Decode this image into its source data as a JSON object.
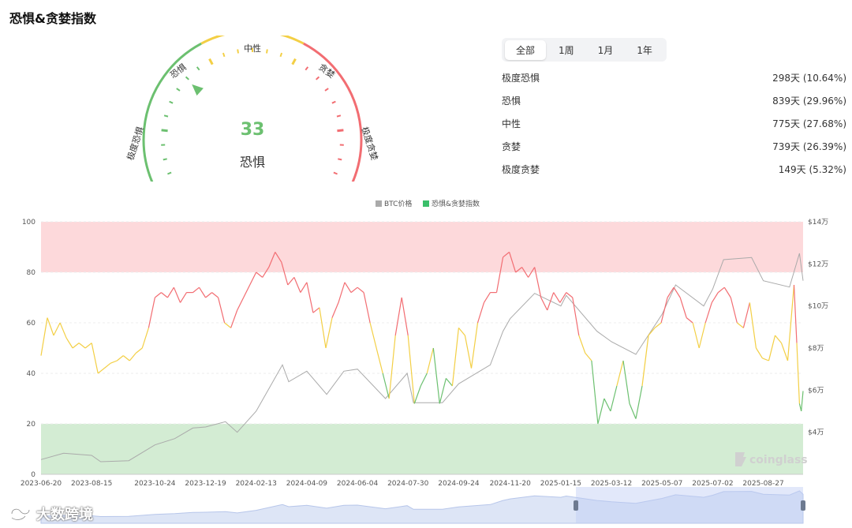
{
  "title": "恐惧&贪婪指数",
  "gauge": {
    "value": "33",
    "value_num": 33,
    "status": "恐惧",
    "labels": {
      "extreme_fear": "极度恐惧",
      "fear": "恐惧",
      "neutral": "中性",
      "greed": "贪婪",
      "extreme_greed": "极度贪婪"
    },
    "colors": {
      "fear": "#6cc070",
      "neutral": "#f3cf45",
      "greed": "#f26d72"
    }
  },
  "tabs": [
    {
      "label": "全部",
      "active": true
    },
    {
      "label": "1周",
      "active": false
    },
    {
      "label": "1月",
      "active": false
    },
    {
      "label": "1年",
      "active": false
    }
  ],
  "stats": [
    {
      "label": "极度恐惧",
      "value": "298天 (10.64%)"
    },
    {
      "label": "恐惧",
      "value": "839天 (29.96%)"
    },
    {
      "label": "中性",
      "value": "775天 (27.68%)"
    },
    {
      "label": "贪婪",
      "value": "739天 (26.39%)"
    },
    {
      "label": "极度贪婪",
      "value": "149天 (5.32%)"
    }
  ],
  "chart_data": {
    "type": "line",
    "legend": [
      "BTC价格",
      "恐惧&贪婪指数"
    ],
    "legend_position": "top-center",
    "colors": {
      "btc": "#aaaaaa",
      "fear": "#6cc070",
      "neutral": "#f3cf45",
      "greed": "#f26d72",
      "greed_band": "#fdd9db",
      "fear_band": "#d3ecd3"
    },
    "y_left": {
      "min": 0,
      "max": 100,
      "ticks": [
        "0",
        "20",
        "40",
        "60",
        "80",
        "100"
      ]
    },
    "y_right": {
      "min": 20000,
      "max": 140000,
      "ticks": [
        "$4万",
        "$6万",
        "$8万",
        "$10万",
        "$12万",
        "$14万"
      ],
      "tick_values": [
        40000,
        60000,
        80000,
        100000,
        120000,
        140000
      ]
    },
    "bands": [
      {
        "from": 80,
        "to": 100
      },
      {
        "from": 0,
        "to": 20
      }
    ],
    "x_ticks": [
      "2023-06-20",
      "2023-08-15",
      "2023-10-24",
      "2023-12-19",
      "2024-02-13",
      "2024-04-09",
      "2024-06-04",
      "2024-07-30",
      "2024-09-24",
      "2024-11-20",
      "2025-01-15",
      "2025-03-12",
      "2025-05-07",
      "2025-07-02",
      "2025-08-27"
    ],
    "x_start": "2023-06-20",
    "x_end": "2025-10-10",
    "series": [
      {
        "name": "恐惧&贪婪指数",
        "points": [
          [
            "2023-06-20",
            47
          ],
          [
            "2023-06-27",
            62
          ],
          [
            "2023-07-04",
            55
          ],
          [
            "2023-07-11",
            60
          ],
          [
            "2023-07-18",
            54
          ],
          [
            "2023-07-25",
            50
          ],
          [
            "2023-08-01",
            52
          ],
          [
            "2023-08-08",
            50
          ],
          [
            "2023-08-15",
            52
          ],
          [
            "2023-08-22",
            40
          ],
          [
            "2023-08-29",
            42
          ],
          [
            "2023-09-05",
            44
          ],
          [
            "2023-09-12",
            45
          ],
          [
            "2023-09-19",
            47
          ],
          [
            "2023-09-26",
            45
          ],
          [
            "2023-10-03",
            48
          ],
          [
            "2023-10-10",
            50
          ],
          [
            "2023-10-17",
            58
          ],
          [
            "2023-10-24",
            70
          ],
          [
            "2023-10-31",
            72
          ],
          [
            "2023-11-07",
            70
          ],
          [
            "2023-11-14",
            74
          ],
          [
            "2023-11-21",
            68
          ],
          [
            "2023-11-28",
            72
          ],
          [
            "2023-12-05",
            72
          ],
          [
            "2023-12-12",
            74
          ],
          [
            "2023-12-19",
            70
          ],
          [
            "2023-12-26",
            72
          ],
          [
            "2024-01-02",
            70
          ],
          [
            "2024-01-09",
            60
          ],
          [
            "2024-01-16",
            58
          ],
          [
            "2024-01-23",
            65
          ],
          [
            "2024-01-30",
            70
          ],
          [
            "2024-02-06",
            75
          ],
          [
            "2024-02-13",
            80
          ],
          [
            "2024-02-20",
            78
          ],
          [
            "2024-02-27",
            82
          ],
          [
            "2024-03-05",
            88
          ],
          [
            "2024-03-12",
            84
          ],
          [
            "2024-03-19",
            75
          ],
          [
            "2024-03-26",
            78
          ],
          [
            "2024-04-02",
            72
          ],
          [
            "2024-04-09",
            76
          ],
          [
            "2024-04-16",
            64
          ],
          [
            "2024-04-23",
            66
          ],
          [
            "2024-04-30",
            50
          ],
          [
            "2024-05-07",
            62
          ],
          [
            "2024-05-14",
            68
          ],
          [
            "2024-05-21",
            76
          ],
          [
            "2024-05-28",
            72
          ],
          [
            "2024-06-04",
            74
          ],
          [
            "2024-06-11",
            72
          ],
          [
            "2024-06-18",
            60
          ],
          [
            "2024-06-25",
            50
          ],
          [
            "2024-07-02",
            40
          ],
          [
            "2024-07-09",
            30
          ],
          [
            "2024-07-16",
            55
          ],
          [
            "2024-07-23",
            70
          ],
          [
            "2024-07-30",
            55
          ],
          [
            "2024-08-06",
            28
          ],
          [
            "2024-08-13",
            35
          ],
          [
            "2024-08-20",
            40
          ],
          [
            "2024-08-27",
            50
          ],
          [
            "2024-09-03",
            28
          ],
          [
            "2024-09-10",
            38
          ],
          [
            "2024-09-17",
            35
          ],
          [
            "2024-09-24",
            58
          ],
          [
            "2024-10-01",
            55
          ],
          [
            "2024-10-08",
            42
          ],
          [
            "2024-10-15",
            60
          ],
          [
            "2024-10-22",
            68
          ],
          [
            "2024-10-29",
            72
          ],
          [
            "2024-11-05",
            72
          ],
          [
            "2024-11-12",
            86
          ],
          [
            "2024-11-19",
            88
          ],
          [
            "2024-11-26",
            80
          ],
          [
            "2024-12-03",
            82
          ],
          [
            "2024-12-10",
            78
          ],
          [
            "2024-12-17",
            82
          ],
          [
            "2024-12-24",
            70
          ],
          [
            "2024-12-31",
            65
          ],
          [
            "2025-01-07",
            72
          ],
          [
            "2025-01-14",
            68
          ],
          [
            "2025-01-21",
            72
          ],
          [
            "2025-01-28",
            70
          ],
          [
            "2025-02-04",
            55
          ],
          [
            "2025-02-11",
            48
          ],
          [
            "2025-02-18",
            45
          ],
          [
            "2025-02-25",
            20
          ],
          [
            "2025-03-04",
            30
          ],
          [
            "2025-03-11",
            25
          ],
          [
            "2025-03-18",
            35
          ],
          [
            "2025-03-25",
            45
          ],
          [
            "2025-04-01",
            28
          ],
          [
            "2025-04-08",
            22
          ],
          [
            "2025-04-15",
            35
          ],
          [
            "2025-04-22",
            55
          ],
          [
            "2025-04-29",
            58
          ],
          [
            "2025-05-06",
            60
          ],
          [
            "2025-05-13",
            70
          ],
          [
            "2025-05-20",
            74
          ],
          [
            "2025-05-27",
            70
          ],
          [
            "2025-06-03",
            62
          ],
          [
            "2025-06-10",
            60
          ],
          [
            "2025-06-17",
            50
          ],
          [
            "2025-06-24",
            60
          ],
          [
            "2025-07-01",
            68
          ],
          [
            "2025-07-08",
            72
          ],
          [
            "2025-07-15",
            74
          ],
          [
            "2025-07-22",
            70
          ],
          [
            "2025-07-29",
            60
          ],
          [
            "2025-08-05",
            58
          ],
          [
            "2025-08-12",
            68
          ],
          [
            "2025-08-19",
            50
          ],
          [
            "2025-08-26",
            46
          ],
          [
            "2025-09-02",
            45
          ],
          [
            "2025-09-09",
            55
          ],
          [
            "2025-09-16",
            52
          ],
          [
            "2025-09-23",
            45
          ],
          [
            "2025-09-30",
            75
          ],
          [
            "2025-10-03",
            52
          ],
          [
            "2025-10-06",
            28
          ],
          [
            "2025-10-08",
            25
          ],
          [
            "2025-10-10",
            33
          ]
        ]
      },
      {
        "name": "BTC价格",
        "points": [
          [
            "2023-06-20",
            27000
          ],
          [
            "2023-07-15",
            30000
          ],
          [
            "2023-08-15",
            29000
          ],
          [
            "2023-08-25",
            26000
          ],
          [
            "2023-09-25",
            26500
          ],
          [
            "2023-10-24",
            34000
          ],
          [
            "2023-11-15",
            37000
          ],
          [
            "2023-12-05",
            42000
          ],
          [
            "2023-12-19",
            42500
          ],
          [
            "2024-01-10",
            45000
          ],
          [
            "2024-01-23",
            40000
          ],
          [
            "2024-02-13",
            50000
          ],
          [
            "2024-03-13",
            72000
          ],
          [
            "2024-03-20",
            64000
          ],
          [
            "2024-04-09",
            69000
          ],
          [
            "2024-05-01",
            58000
          ],
          [
            "2024-05-20",
            69000
          ],
          [
            "2024-06-04",
            70000
          ],
          [
            "2024-07-05",
            56000
          ],
          [
            "2024-07-29",
            68000
          ],
          [
            "2024-08-05",
            54000
          ],
          [
            "2024-09-06",
            54000
          ],
          [
            "2024-09-24",
            63000
          ],
          [
            "2024-10-29",
            72000
          ],
          [
            "2024-11-12",
            88000
          ],
          [
            "2024-11-20",
            94000
          ],
          [
            "2024-12-17",
            106000
          ],
          [
            "2025-01-15",
            100000
          ],
          [
            "2025-01-21",
            105000
          ],
          [
            "2025-02-24",
            88000
          ],
          [
            "2025-03-12",
            83000
          ],
          [
            "2025-04-08",
            77000
          ],
          [
            "2025-05-07",
            96000
          ],
          [
            "2025-05-22",
            110000
          ],
          [
            "2025-06-22",
            100000
          ],
          [
            "2025-07-02",
            108000
          ],
          [
            "2025-07-14",
            122000
          ],
          [
            "2025-08-14",
            123000
          ],
          [
            "2025-08-27",
            112000
          ],
          [
            "2025-09-25",
            109000
          ],
          [
            "2025-10-06",
            125000
          ],
          [
            "2025-10-10",
            112000
          ]
        ]
      }
    ],
    "watermark": "coinglass"
  },
  "watermark": {
    "text": "大数跨境"
  }
}
